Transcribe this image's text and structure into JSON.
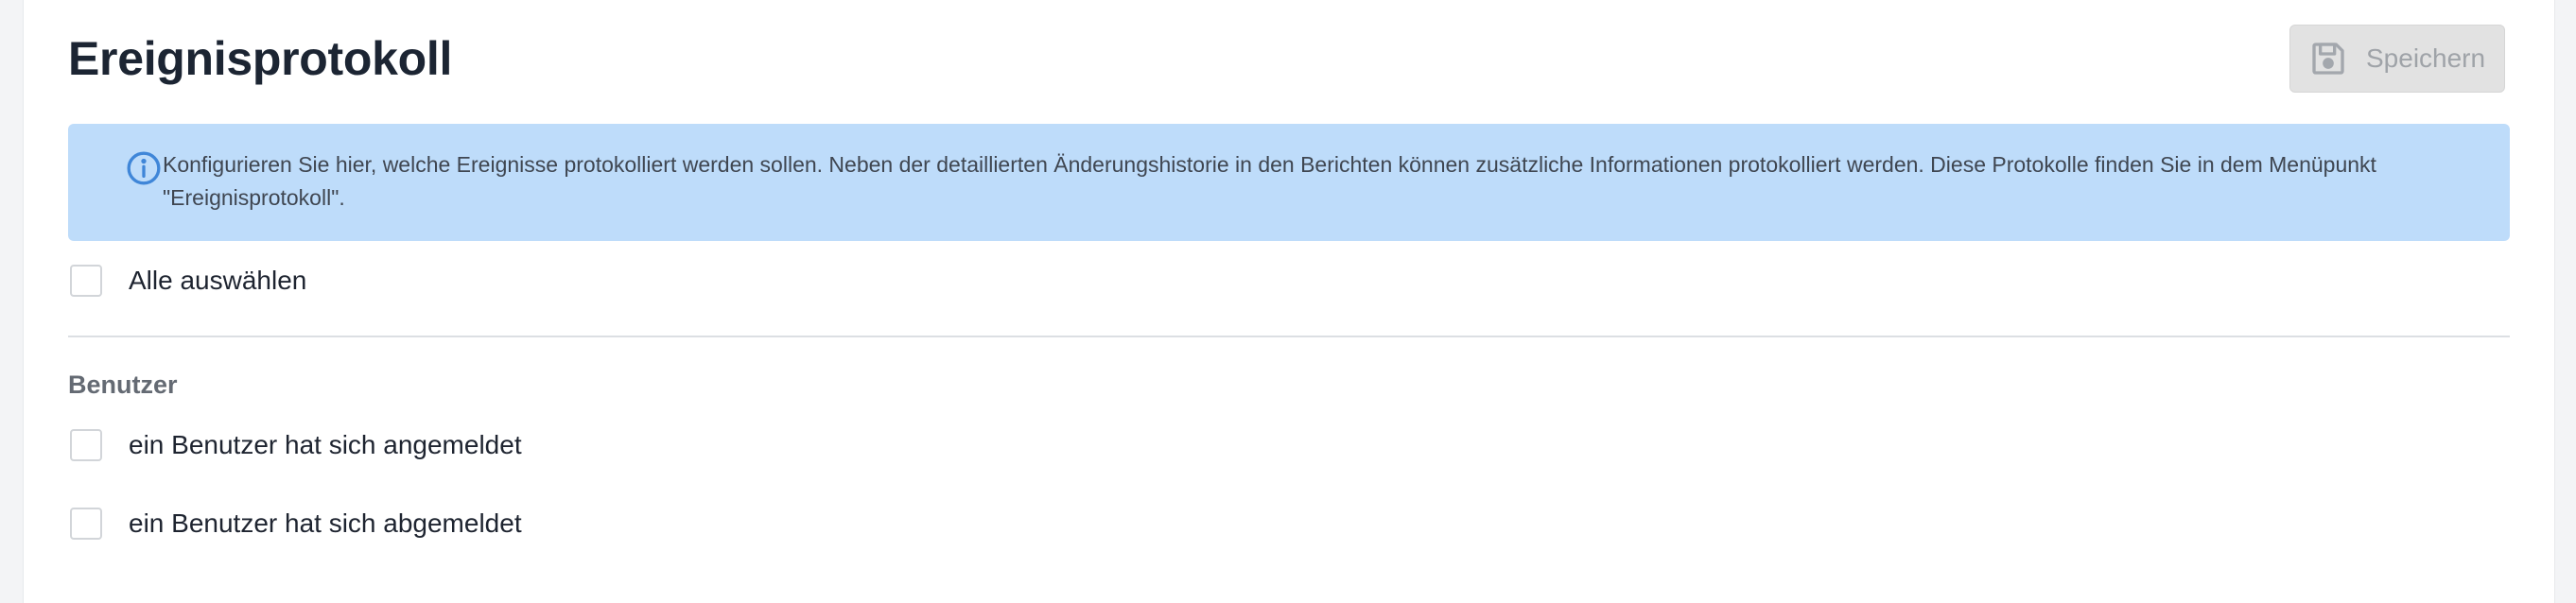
{
  "header": {
    "title": "Ereignisprotokoll",
    "save_label": "Speichern"
  },
  "info": {
    "icon": "info-circle-icon",
    "text": "Konfigurieren Sie hier, welche Ereignisse protokolliert werden sollen. Neben der detaillierten Änderungshistorie in den Berichten können zusätzliche Informationen protokolliert werden. Diese Protokolle finden Sie in dem Menüpunkt \"Ereignisprotokoll\"."
  },
  "select_all": {
    "label": "Alle auswählen",
    "checked": false
  },
  "sections": [
    {
      "title": "Benutzer",
      "items": [
        {
          "label": "ein Benutzer hat sich angemeldet",
          "checked": false
        },
        {
          "label": "ein Benutzer hat sich abgemeldet",
          "checked": false
        }
      ]
    }
  ],
  "colors": {
    "info_background": "#bedcfa",
    "info_icon": "#3f86d8",
    "title": "#1c2533",
    "save_disabled_bg": "#e2e2e2"
  }
}
